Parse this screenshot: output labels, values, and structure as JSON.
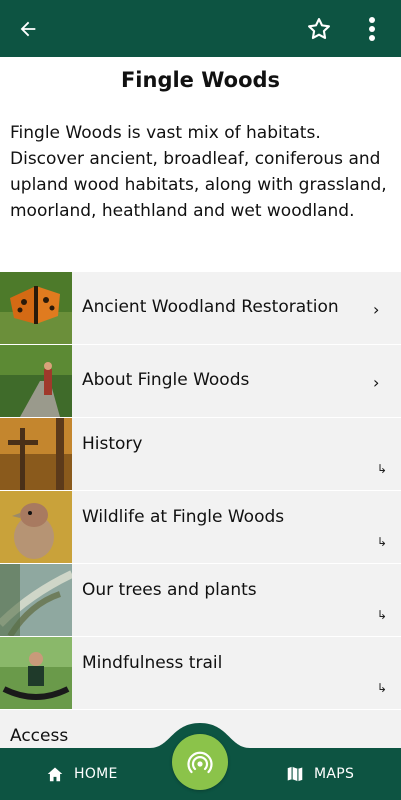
{
  "header": {
    "back_icon": "arrow-left-icon",
    "favorite_icon": "star-outline-icon",
    "more_icon": "more-vertical-icon",
    "background": "#0d5442"
  },
  "page": {
    "title": "Fingle Woods",
    "description": "Fingle Woods is vast mix of habitats. Discover ancient, broadleaf, coniferous and upland wood habitats, along with grassland, moorland, heathland and wet woodland."
  },
  "list": {
    "items": [
      {
        "label": "Ancient Woodland Restoration",
        "indicator": "chevron-right-icon",
        "thumbnail": "butterfly-photo"
      },
      {
        "label": "About Fingle Woods",
        "indicator": "chevron-right-icon",
        "thumbnail": "woodland-path-photo"
      },
      {
        "label": "History",
        "indicator": "subdirectory-arrow-icon",
        "thumbnail": "autumn-signpost-photo"
      },
      {
        "label": "Wildlife at Fingle Woods",
        "indicator": "subdirectory-arrow-icon",
        "thumbnail": "bird-photo"
      },
      {
        "label": "Our trees and plants",
        "indicator": "subdirectory-arrow-icon",
        "thumbnail": "trees-photo"
      },
      {
        "label": "Mindfulness trail",
        "indicator": "subdirectory-arrow-icon",
        "thumbnail": "hammock-person-photo"
      },
      {
        "label": "Access",
        "indicator": "subdirectory-arrow-icon",
        "thumbnail": ""
      }
    ]
  },
  "bottom_nav": {
    "home_label": "HOME",
    "home_icon": "home-icon",
    "maps_label": "MAPS",
    "maps_icon": "map-icon",
    "center_icon": "broadcast-signal-icon",
    "center_color": "#8bc34a",
    "background": "#0d5442"
  }
}
